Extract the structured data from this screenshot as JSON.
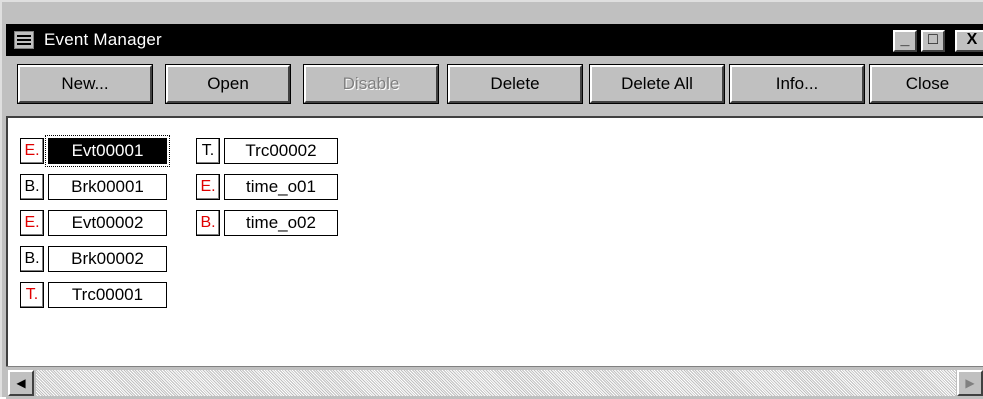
{
  "window": {
    "title": "Event Manager",
    "minimize": "_",
    "maximize": "□",
    "close": "X"
  },
  "toolbar": {
    "buttons": [
      {
        "label": "New...",
        "enabled": true
      },
      {
        "label": "Open",
        "enabled": true
      },
      {
        "label": "Disable",
        "enabled": false
      },
      {
        "label": "Delete",
        "enabled": true
      },
      {
        "label": "Delete All",
        "enabled": true
      },
      {
        "label": "Info...",
        "enabled": true
      },
      {
        "label": "Close",
        "enabled": true
      }
    ]
  },
  "events": {
    "column1": [
      {
        "type": "E.",
        "type_color": "#e00000",
        "name": "Evt00001",
        "selected": true
      },
      {
        "type": "B.",
        "type_color": "#000000",
        "name": "Brk00001",
        "selected": false
      },
      {
        "type": "E.",
        "type_color": "#e00000",
        "name": "Evt00002",
        "selected": false
      },
      {
        "type": "B.",
        "type_color": "#000000",
        "name": "Brk00002",
        "selected": false
      },
      {
        "type": "T.",
        "type_color": "#e00000",
        "name": "Trc00001",
        "selected": false
      }
    ],
    "column2": [
      {
        "type": "T.",
        "type_color": "#000000",
        "name": "Trc00002",
        "selected": false
      },
      {
        "type": "E.",
        "type_color": "#e00000",
        "name": "time_o01",
        "selected": false
      },
      {
        "type": "B.",
        "type_color": "#e00000",
        "name": "time_o02",
        "selected": false
      }
    ]
  },
  "scrollbar": {
    "left_arrow": "◀",
    "right_arrow": "▶"
  },
  "colors": {
    "title_bar": "#000000",
    "chrome": "#c0c0c0",
    "accent_red": "#e00000"
  }
}
